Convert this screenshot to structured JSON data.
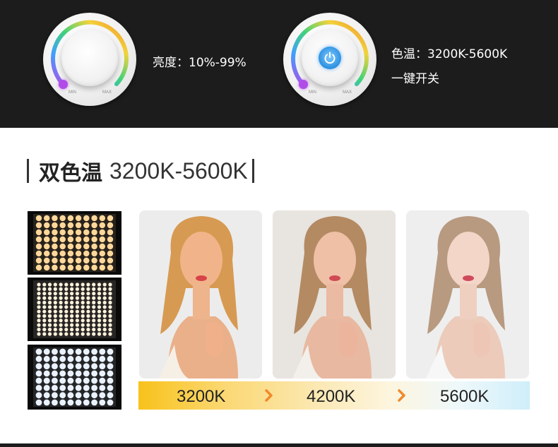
{
  "specs": {
    "brightness": "亮度：10%-99%",
    "color_temp": "色温：3200K-5600K",
    "one_key": "一键开关"
  },
  "dial": {
    "min_label": "MIN",
    "max_label": "MAX"
  },
  "heading": {
    "bold": "双色温",
    "light": "3200K-5600K"
  },
  "led_panels": [
    {
      "tone": "warm",
      "color": "#ffd79a"
    },
    {
      "tone": "neutral",
      "color": "#fff1dc"
    },
    {
      "tone": "cool",
      "color": "#eaf2ff"
    }
  ],
  "color_temps": {
    "warm": "3200K",
    "neutral": "4200K",
    "cool": "5600K"
  },
  "colors": {
    "dark_band": "#1c1c1c",
    "arrow": "#f08a2c",
    "power_blue": "#2b8fe0",
    "indicator_purple": "#b24ce8"
  }
}
